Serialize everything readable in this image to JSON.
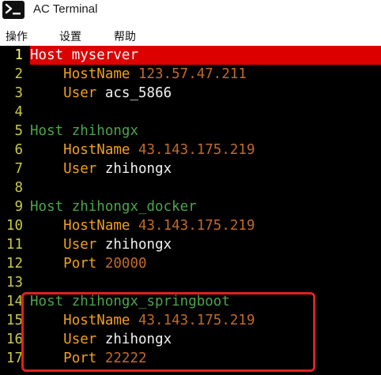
{
  "window": {
    "title": "AC Terminal",
    "icon": "terminal-prompt-icon"
  },
  "menubar": {
    "items": [
      "操作",
      "设置",
      "帮助"
    ]
  },
  "editor": {
    "current_line": 1,
    "lines": [
      {
        "num": "1",
        "segments": [
          {
            "cls": "tok-host",
            "text": "Host"
          },
          {
            "cls": "tok-hostalias",
            "text": " myserver"
          }
        ]
      },
      {
        "num": "2",
        "segments": [
          {
            "cls": "",
            "text": "    "
          },
          {
            "cls": "tok-hostname",
            "text": "HostName"
          },
          {
            "cls": "tok-ip",
            "text": " 123.57.47.211"
          }
        ]
      },
      {
        "num": "3",
        "segments": [
          {
            "cls": "",
            "text": "    "
          },
          {
            "cls": "tok-user",
            "text": "User"
          },
          {
            "cls": "tok-username",
            "text": " acs_5866"
          }
        ]
      },
      {
        "num": "4",
        "segments": []
      },
      {
        "num": "5",
        "segments": [
          {
            "cls": "tok-host",
            "text": "Host"
          },
          {
            "cls": "tok-hostalias",
            "text": " zhihongx"
          }
        ]
      },
      {
        "num": "6",
        "segments": [
          {
            "cls": "",
            "text": "    "
          },
          {
            "cls": "tok-hostname",
            "text": "HostName"
          },
          {
            "cls": "tok-ip",
            "text": " 43.143.175.219"
          }
        ]
      },
      {
        "num": "7",
        "segments": [
          {
            "cls": "",
            "text": "    "
          },
          {
            "cls": "tok-user",
            "text": "User"
          },
          {
            "cls": "tok-username",
            "text": " zhihongx"
          }
        ]
      },
      {
        "num": "8",
        "segments": []
      },
      {
        "num": "9",
        "segments": [
          {
            "cls": "tok-host",
            "text": "Host"
          },
          {
            "cls": "tok-hostalias",
            "text": " zhihongx_docker"
          }
        ]
      },
      {
        "num": "10",
        "segments": [
          {
            "cls": "",
            "text": "    "
          },
          {
            "cls": "tok-hostname",
            "text": "HostName"
          },
          {
            "cls": "tok-ip",
            "text": " 43.143.175.219"
          }
        ]
      },
      {
        "num": "11",
        "segments": [
          {
            "cls": "",
            "text": "    "
          },
          {
            "cls": "tok-user",
            "text": "User"
          },
          {
            "cls": "tok-username",
            "text": " zhihongx"
          }
        ]
      },
      {
        "num": "12",
        "segments": [
          {
            "cls": "",
            "text": "    "
          },
          {
            "cls": "tok-port",
            "text": "Port"
          },
          {
            "cls": "tok-portval",
            "text": " 20000"
          }
        ]
      },
      {
        "num": "13",
        "segments": []
      },
      {
        "num": "14",
        "segments": [
          {
            "cls": "tok-host",
            "text": "Host"
          },
          {
            "cls": "tok-hostalias",
            "text": " zhihongx_springboot"
          }
        ]
      },
      {
        "num": "15",
        "segments": [
          {
            "cls": "",
            "text": "    "
          },
          {
            "cls": "tok-hostname",
            "text": "HostName"
          },
          {
            "cls": "tok-ip",
            "text": " 43.143.175.219"
          }
        ]
      },
      {
        "num": "16",
        "segments": [
          {
            "cls": "",
            "text": "    "
          },
          {
            "cls": "tok-user",
            "text": "User"
          },
          {
            "cls": "tok-username",
            "text": " zhihongx"
          }
        ]
      },
      {
        "num": "17",
        "segments": [
          {
            "cls": "",
            "text": "    "
          },
          {
            "cls": "tok-port",
            "text": "Port"
          },
          {
            "cls": "tok-portval",
            "text": " 22222"
          }
        ]
      }
    ]
  },
  "annotation": {
    "color": "#e0211f",
    "target_lines": [
      "14",
      "15",
      "16",
      "17"
    ]
  },
  "colors": {
    "editor_bg": "#000000",
    "current_line_bg": "#dd0000",
    "line_number": "#c9c94a",
    "host_keyword": "#4da34d",
    "key_keyword": "#f0a01c",
    "value_number": "#c06a2a",
    "value_text": "#f2f2f2"
  }
}
